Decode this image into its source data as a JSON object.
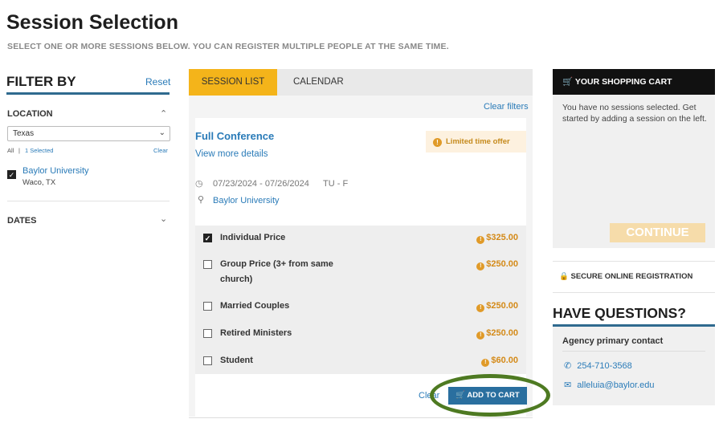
{
  "page": {
    "title": "Session Selection",
    "subtitle": "SELECT ONE OR MORE SESSIONS BELOW. YOU CAN REGISTER MULTIPLE PEOPLE AT THE SAME TIME."
  },
  "filter": {
    "title": "FILTER BY",
    "reset": "Reset",
    "location_label": "LOCATION",
    "location_select": "Texas",
    "all": "All",
    "sep": "|",
    "selected": "1 Selected",
    "clear": "Clear",
    "location_option": {
      "name": "Baylor University",
      "city": "Waco, TX",
      "checked": true
    },
    "dates_label": "DATES"
  },
  "tabs": {
    "active": "SESSION LIST",
    "other": "CALENDAR"
  },
  "list": {
    "clear_filters": "Clear filters",
    "session": {
      "title": "Full Conference",
      "details_link": "View more details",
      "badge": "Limited time offer",
      "dates": "07/23/2024 - 07/26/2024",
      "days": "TU - F",
      "venue": "Baylor University"
    },
    "prices": [
      {
        "label": "Individual Price",
        "amount": "$325.00",
        "checked": true
      },
      {
        "label": "Group Price (3+ from same",
        "label2": "church)",
        "amount": "$250.00",
        "checked": false
      },
      {
        "label": "Married Couples",
        "amount": "$250.00",
        "checked": false
      },
      {
        "label": "Retired Ministers",
        "amount": "$250.00",
        "checked": false
      },
      {
        "label": "Student",
        "amount": "$60.00",
        "checked": false
      }
    ],
    "clear": "Clear",
    "add_to_cart": "ADD TO CART"
  },
  "cart": {
    "title": "YOUR SHOPPING CART",
    "message": "You have no sessions selected. Get started by adding a session on the left.",
    "continue": "CONTINUE"
  },
  "secure": "SECURE ONLINE REGISTRATION",
  "questions": {
    "title": "HAVE QUESTIONS?",
    "contact_label": "Agency primary contact",
    "phone": "254-710-3568",
    "email": "alleluia@baylor.edu"
  },
  "colors": {
    "accent": "#f4b41a",
    "link": "#2a7bb8",
    "button": "#2a6f9f",
    "price": "#d48a18",
    "annotation_ring": "#4e7a22"
  }
}
